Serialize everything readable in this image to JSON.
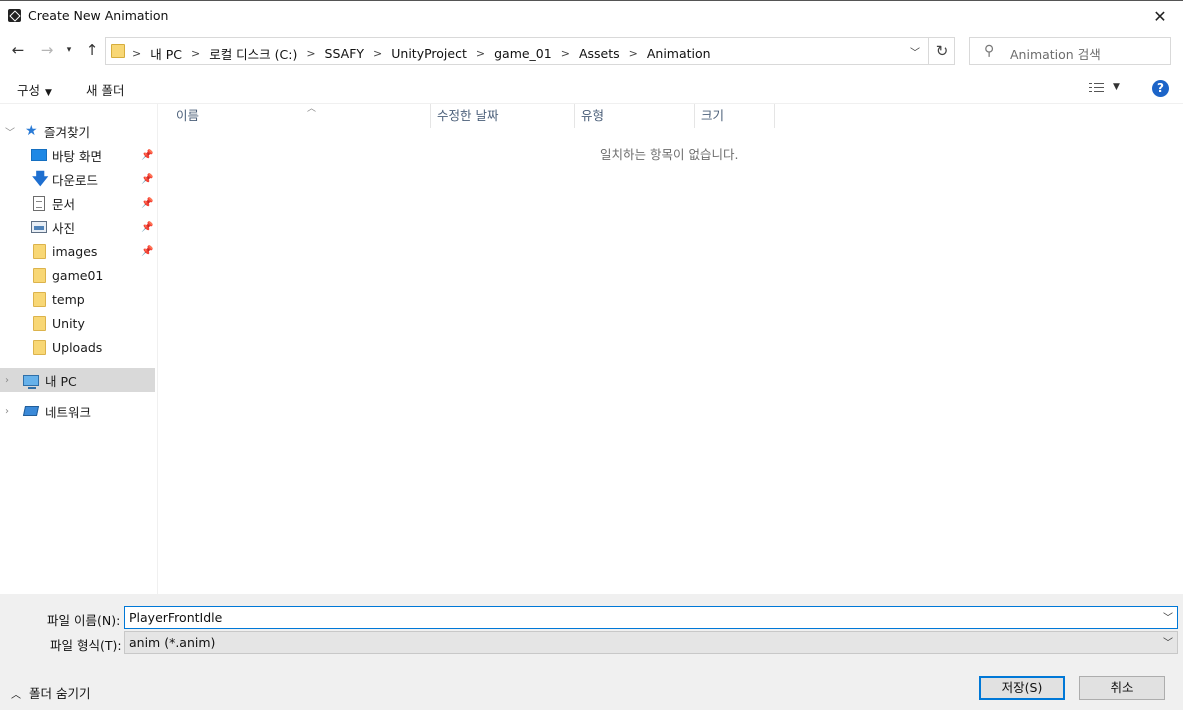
{
  "window": {
    "title": "Create New Animation",
    "close_symbol": "✕"
  },
  "address": {
    "breadcrumbs": [
      "내 PC",
      "로컬 디스크 (C:)",
      "SSAFY",
      "UnityProject",
      "game_01",
      "Assets",
      "Animation"
    ],
    "separator": ">"
  },
  "search": {
    "placeholder": "Animation 검색"
  },
  "toolbar": {
    "organize_label": "구성",
    "new_folder_label": "새 폴더",
    "help_label": "?"
  },
  "nav": {
    "quick_access_label": "즐겨찾기",
    "items": [
      {
        "label": "바탕 화면",
        "icon": "desktop-icon",
        "pinned": true
      },
      {
        "label": "다운로드",
        "icon": "download-icon",
        "pinned": true
      },
      {
        "label": "문서",
        "icon": "document-icon",
        "pinned": true
      },
      {
        "label": "사진",
        "icon": "pictures-icon",
        "pinned": true
      },
      {
        "label": "images",
        "icon": "folder-icon",
        "pinned": true
      },
      {
        "label": "game01",
        "icon": "folder-icon",
        "pinned": false
      },
      {
        "label": "temp",
        "icon": "folder-icon",
        "pinned": false
      },
      {
        "label": "Unity",
        "icon": "folder-icon",
        "pinned": false
      },
      {
        "label": "Uploads",
        "icon": "folder-icon",
        "pinned": false
      }
    ],
    "this_pc_label": "내 PC",
    "network_label": "네트워크"
  },
  "file_list": {
    "columns": [
      "이름",
      "수정한 날짜",
      "유형",
      "크기"
    ],
    "empty_message": "일치하는 항목이 없습니다."
  },
  "save_panel": {
    "filename_label": "파일 이름(N):",
    "filename_value": "PlayerFrontIdle",
    "filetype_label": "파일 형식(T):",
    "filetype_value": "anim (*.anim)",
    "hide_folders_label": "폴더 숨기기",
    "save_button": "저장(S)",
    "cancel_button": "취소"
  },
  "colors": {
    "accent": "#0078d7",
    "help_blue": "#1c64c8",
    "selection": "#d9d9d9"
  }
}
